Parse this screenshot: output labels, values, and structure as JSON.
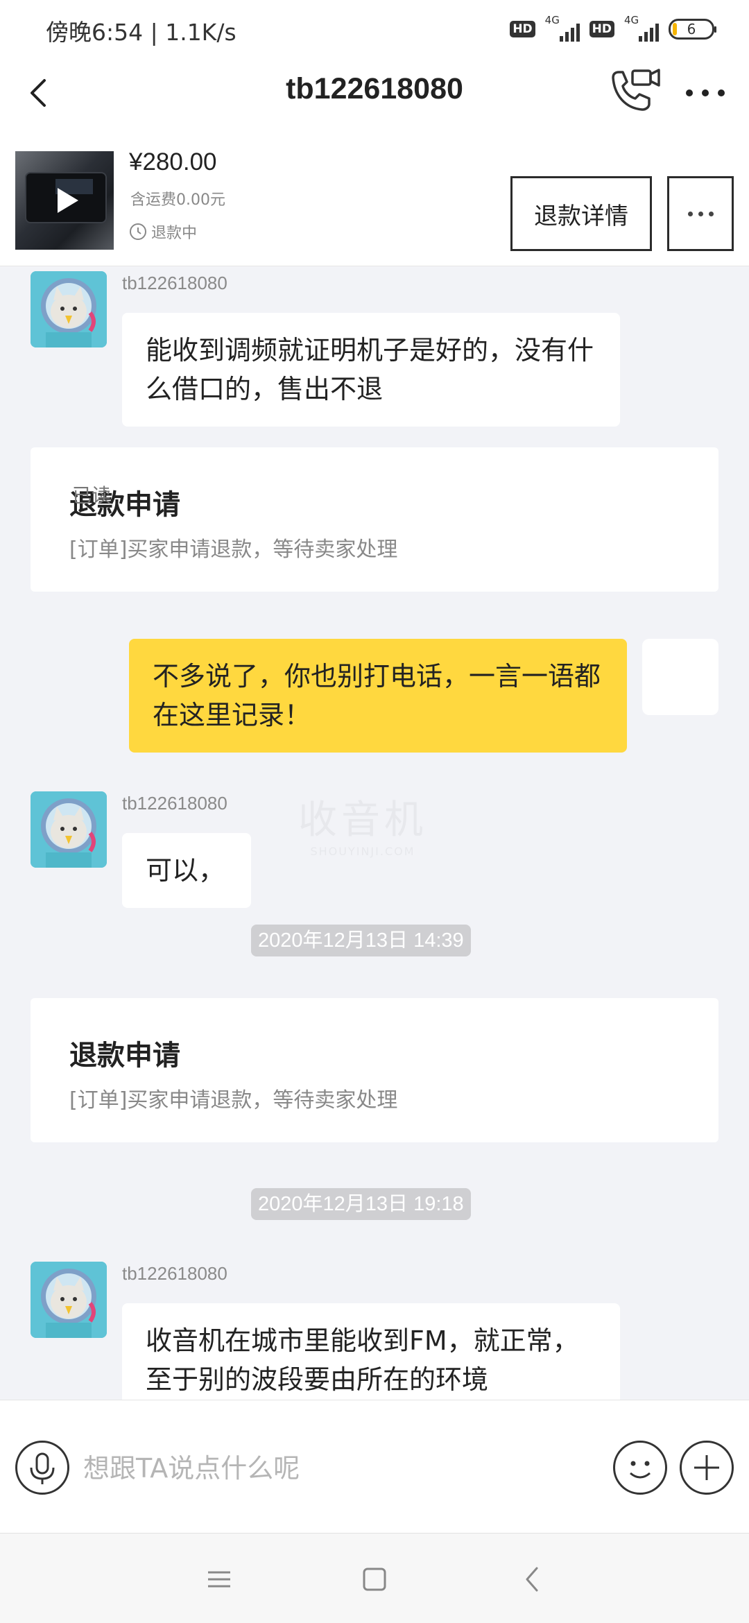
{
  "status_bar": {
    "time_speed": "傍晚6:54 | 1.1K/s",
    "hd_label": "HD",
    "network_label": "4G",
    "battery_level": "6"
  },
  "header": {
    "title": "tb122618080",
    "icons": [
      "back-arrow-icon",
      "video-call-icon",
      "more-dots-icon"
    ]
  },
  "product": {
    "price": "¥280.00",
    "shipping": "含运费0.00元",
    "status": "退款中",
    "refund_detail_label": "退款详情"
  },
  "watermark": {
    "main": "收音机",
    "sub": "SHOUYINJI.COM"
  },
  "messages": {
    "msg1": {
      "sender": "tb122618080",
      "text": "能收到调频就证明机子是好的，没有什么借口的，售出不退"
    },
    "card1": {
      "title": "退款申请",
      "desc": "[订单]买家申请退款，等待卖家处理"
    },
    "msg2": {
      "read": "已读",
      "text": "不多说了，你也别打电话，一言一语都在这里记录！"
    },
    "msg3": {
      "sender": "tb122618080",
      "text": "可以，"
    },
    "time1": "2020年12月13日 14:39",
    "card2": {
      "title": "退款申请",
      "desc": "[订单]买家申请退款，等待卖家处理"
    },
    "time2": "2020年12月13日 19:18",
    "msg4": {
      "sender": "tb122618080",
      "text": "收音机在城市里能收到FM，就正常，至于别的波段要由所在的环境"
    }
  },
  "input_bar": {
    "placeholder": "想跟TA说点什么呢"
  },
  "colors": {
    "accent_bubble": "#ffd83f",
    "background": "#f2f3f7",
    "time_chip": "#cfcfd2"
  }
}
